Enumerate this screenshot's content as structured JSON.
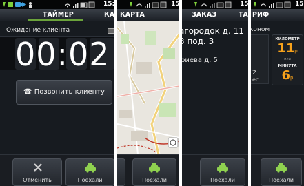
{
  "status": {
    "time": "15:",
    "time_short": "15"
  },
  "panel_timer": {
    "tab_title": "ТАЙМЕР",
    "tab_next": "КА",
    "waiting_label": "Ожидание клиента",
    "timer_value": "00:02",
    "call_button": "Позвонить клиенту",
    "cancel_button": "Отменить",
    "go_button": "Поехали"
  },
  "panel_map": {
    "tab_title": "КАРТА",
    "go_button": "Поехали"
  },
  "panel_order": {
    "tab_title": "ЗАКАЗ",
    "tab_next": "ТА",
    "address_line1": "агородок д. 11",
    "address_line2": "3 под. 3",
    "address_line3": "риева д. 5",
    "go_button": "Поехали"
  },
  "panel_tariff": {
    "tab_title": "РИФ",
    "mode_label": "коном",
    "km_label": "КИЛОМЕТР",
    "km_value": "11",
    "km_currency": "р",
    "per_label": "или",
    "min_label": "МИНУТА",
    "min_value": "6",
    "min_currency": "р",
    "stub_1": "2",
    "stub_2": "ес",
    "go_button": "Поехали"
  },
  "colors": {
    "accent_green": "#6ba33b",
    "tariff_orange": "#f7a21b",
    "panel_bg": "#171b20"
  }
}
